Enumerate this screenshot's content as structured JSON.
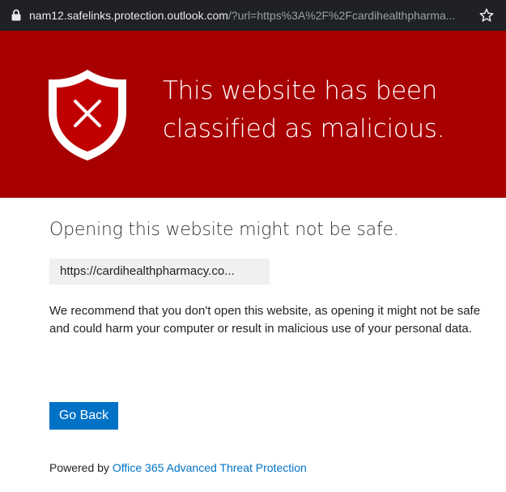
{
  "browser": {
    "url_host": "nam12.safelinks.protection.outlook.com",
    "url_path": "/?url=https%3A%2F%2Fcardihealthpharma...",
    "lock_icon": "lock-icon",
    "bookmark_icon": "star-icon"
  },
  "banner": {
    "background_color": "#a80000",
    "icon": "shield-x-icon",
    "headline_line1": "This website has been",
    "headline_line2": "classified as malicious."
  },
  "content": {
    "subheading": "Opening this website might not be safe.",
    "blocked_url": "https://cardihealthpharmacy.co...",
    "message": "We recommend that you don't open this website, as opening it might not be safe and could harm your computer or result in malicious use of your personal data.",
    "go_back_label": "Go Back",
    "accent_color": "#0072c6"
  },
  "footer": {
    "powered_by_prefix": "Powered by ",
    "powered_by_link": "Office 365 Advanced Threat Protection"
  }
}
